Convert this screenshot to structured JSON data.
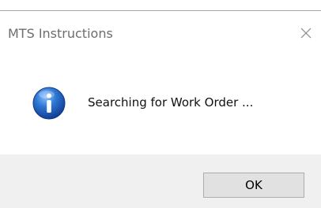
{
  "window": {
    "title": "MTS Instructions",
    "close_icon": "close-icon"
  },
  "message": {
    "icon": "info-icon",
    "text": "Searching for Work Order ..."
  },
  "buttons": {
    "ok_label": "OK"
  },
  "colors": {
    "icon_blue": "#1f5fb8",
    "footer_bg": "#f0f0f0",
    "button_bg": "#e1e1e1",
    "button_border": "#adadad"
  }
}
